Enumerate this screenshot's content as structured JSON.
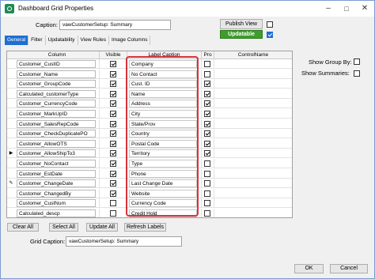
{
  "window": {
    "title": "Dashboard Grid Properties"
  },
  "caption": {
    "label": "Caption:",
    "value": "vawCustomerSetup: Summary"
  },
  "publish_view_label": "Publish View",
  "updatable_label": "Updatable",
  "tabs": [
    {
      "label": "General",
      "active": true
    },
    {
      "label": "Filter",
      "active": false
    },
    {
      "label": "Updatability",
      "active": false
    },
    {
      "label": "View Rules",
      "active": false
    },
    {
      "label": "Image Columns",
      "active": false
    }
  ],
  "grid": {
    "columns": [
      "Column",
      "Visible",
      "Label Caption",
      "Pro",
      "ControlName"
    ],
    "rows": [
      {
        "column": "Customer_CustID",
        "visible": true,
        "caption": "Company",
        "pro": false,
        "indicator": ""
      },
      {
        "column": "Customer_Name",
        "visible": true,
        "caption": "No Contact",
        "pro": false,
        "indicator": ""
      },
      {
        "column": "Customer_GroupCode",
        "visible": true,
        "caption": "Cust. ID",
        "pro": true,
        "indicator": ""
      },
      {
        "column": "Calculated_customerType",
        "visible": true,
        "caption": "Name",
        "pro": true,
        "indicator": ""
      },
      {
        "column": "Customer_CurrencyCode",
        "visible": true,
        "caption": "Address",
        "pro": true,
        "indicator": ""
      },
      {
        "column": "Customer_MarkUpID",
        "visible": true,
        "caption": "City",
        "pro": true,
        "indicator": ""
      },
      {
        "column": "Customer_SalesRepCode",
        "visible": true,
        "caption": "State/Prov",
        "pro": true,
        "indicator": ""
      },
      {
        "column": "Customer_CheckDuplicatePO",
        "visible": true,
        "caption": "Country",
        "pro": true,
        "indicator": ""
      },
      {
        "column": "Customer_AllowOTS",
        "visible": true,
        "caption": "Postal Code",
        "pro": true,
        "indicator": ""
      },
      {
        "column": "Customer_AllowShipTo3",
        "visible": true,
        "caption": "Territory",
        "pro": true,
        "indicator": "▶"
      },
      {
        "column": "Customer_NoContact",
        "visible": true,
        "caption": "Type",
        "pro": false,
        "indicator": ""
      },
      {
        "column": "Customer_EstDate",
        "visible": true,
        "caption": "Phone",
        "pro": false,
        "indicator": ""
      },
      {
        "column": "Customer_ChangeDate",
        "visible": true,
        "caption": "Last Change Date",
        "pro": false,
        "indicator": "✎"
      },
      {
        "column": "Customer_ChangedBy",
        "visible": true,
        "caption": "Website",
        "pro": false,
        "indicator": ""
      },
      {
        "column": "Customer_CustNum",
        "visible": false,
        "caption": "Currency Code",
        "pro": false,
        "indicator": ""
      },
      {
        "column": "Calculated_descp",
        "visible": false,
        "caption": "Credit Hold",
        "pro": false,
        "indicator": ""
      }
    ]
  },
  "options": {
    "show_group_by": "Show Group By:",
    "show_summaries": "Show Summaries:"
  },
  "buttons": {
    "clear_all": "Clear All",
    "select_all": "Select All",
    "update_all": "Update All",
    "refresh_labels": "Refresh Labels",
    "ok": "OK",
    "cancel": "Cancel"
  },
  "grid_caption": {
    "label": "Grid Caption:",
    "value": "vawCustomerSetup: Summary"
  },
  "colors": {
    "accent": "#1e6fd0",
    "updatable": "#3e9e2b",
    "highlight_box": "#d9323c"
  }
}
